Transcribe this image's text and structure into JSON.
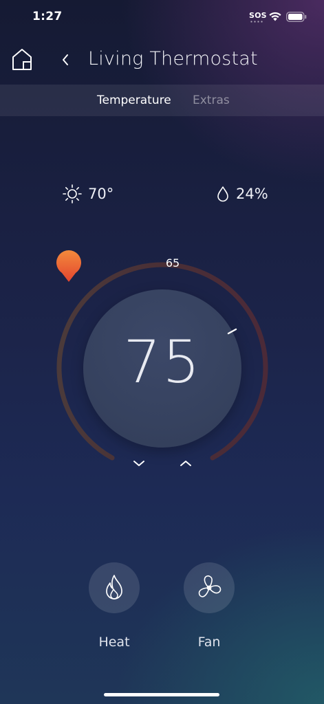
{
  "status_bar": {
    "time": "1:27",
    "sos": "SOS",
    "icons": [
      "wifi-icon",
      "battery-icon"
    ]
  },
  "header": {
    "title": "Living Thermostat",
    "icons": [
      "home-icon",
      "chevron-left-icon"
    ]
  },
  "tabs": [
    {
      "label": "Temperature",
      "selected": true
    },
    {
      "label": "Extras",
      "selected": false
    }
  ],
  "weather": {
    "outdoor_temp": "70°",
    "outdoor_icon": "sun-icon",
    "humidity": "24%",
    "humidity_icon": "droplet-icon"
  },
  "thermostat": {
    "current_temp": "75",
    "setpoint": "65",
    "controls": [
      "chevron-down-icon",
      "chevron-up-icon"
    ]
  },
  "modes": [
    {
      "label": "Heat",
      "icon": "flame-icon"
    },
    {
      "label": "Fan",
      "icon": "fan-icon"
    }
  ],
  "colors": {
    "accent": "#e8553a",
    "setpoint_gradient_top": "#f28a3c",
    "dial_track": "#4a3138"
  }
}
